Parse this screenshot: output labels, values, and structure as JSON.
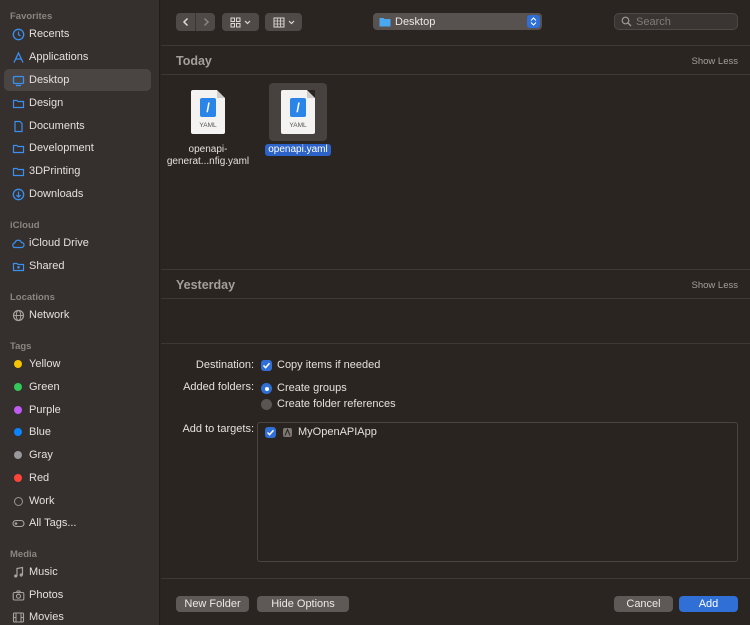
{
  "sidebar": {
    "favorites_heading": "Favorites",
    "favorites": [
      {
        "label": "Recents",
        "icon": "clock-icon"
      },
      {
        "label": "Applications",
        "icon": "applications-icon"
      },
      {
        "label": "Desktop",
        "icon": "desktop-icon",
        "active": true
      },
      {
        "label": "Design",
        "icon": "folder-icon"
      },
      {
        "label": "Documents",
        "icon": "document-icon"
      },
      {
        "label": "Development",
        "icon": "folder-icon"
      },
      {
        "label": "3DPrinting",
        "icon": "folder-icon"
      },
      {
        "label": "Downloads",
        "icon": "download-icon"
      }
    ],
    "icloud_heading": "iCloud",
    "icloud": [
      {
        "label": "iCloud Drive",
        "icon": "cloud-icon"
      },
      {
        "label": "Shared",
        "icon": "shared-folder-icon"
      }
    ],
    "locations_heading": "Locations",
    "locations": [
      {
        "label": "Network",
        "icon": "globe-icon"
      }
    ],
    "tags_heading": "Tags",
    "tags": [
      {
        "label": "Yellow",
        "color": "#f5c400"
      },
      {
        "label": "Green",
        "color": "#34c759"
      },
      {
        "label": "Purple",
        "color": "#bf5af2"
      },
      {
        "label": "Blue",
        "color": "#0a84ff"
      },
      {
        "label": "Gray",
        "color": "#98989d"
      },
      {
        "label": "Red",
        "color": "#ff453a"
      },
      {
        "label": "Work",
        "color": "none"
      },
      {
        "label": "All Tags...",
        "color": "all"
      }
    ],
    "media_heading": "Media",
    "media": [
      {
        "label": "Music",
        "icon": "music-icon"
      },
      {
        "label": "Photos",
        "icon": "camera-icon"
      },
      {
        "label": "Movies",
        "icon": "film-icon"
      }
    ]
  },
  "toolbar": {
    "location": "Desktop",
    "search_placeholder": "Search"
  },
  "groups": {
    "today": {
      "title": "Today",
      "toggle": "Show Less"
    },
    "yesterday": {
      "title": "Yesterday",
      "toggle": "Show Less"
    }
  },
  "files": [
    {
      "line1": "openapi-",
      "line2": "generat...nfig.yaml",
      "ext": "YAML",
      "selected": false
    },
    {
      "line1": "openapi.yaml",
      "line2": "",
      "ext": "YAML",
      "selected": true
    }
  ],
  "options": {
    "destination_label": "Destination:",
    "copy_items": "Copy items if needed",
    "copy_checked": true,
    "added_folders_label": "Added folders:",
    "create_groups": "Create groups",
    "create_folder_refs": "Create folder references",
    "selected_folder_option": "Create groups",
    "targets_label": "Add to targets:",
    "target_name": "MyOpenAPIApp",
    "target_checked": true
  },
  "buttons": {
    "new_folder": "New Folder",
    "hide_options": "Hide Options",
    "cancel": "Cancel",
    "add": "Add"
  },
  "colors": {
    "accent": "#2f6fd6",
    "sidebar_bg": "#35302d",
    "main_bg": "#2b2522"
  }
}
